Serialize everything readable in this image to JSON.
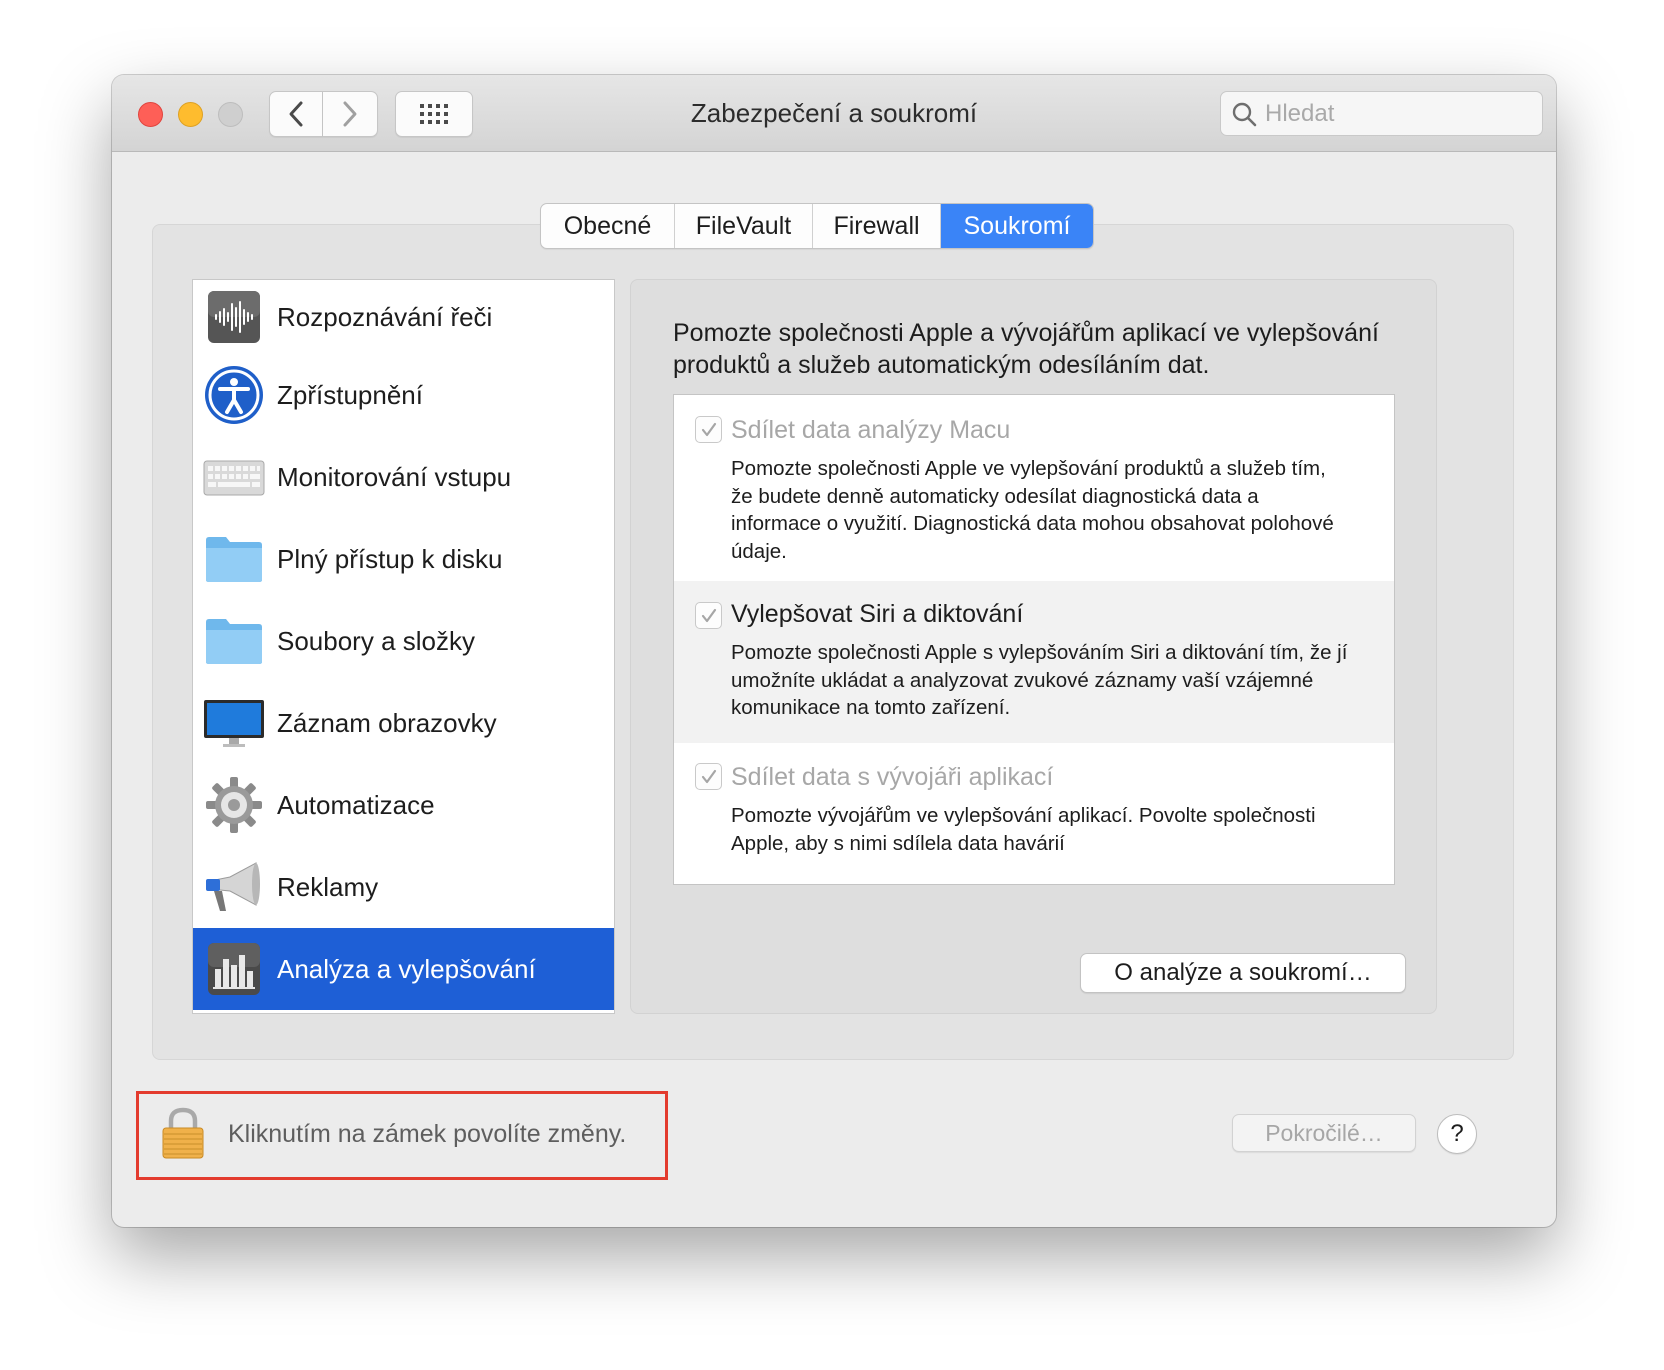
{
  "window": {
    "title": "Zabezpečení a soukromí",
    "search_placeholder": "Hledat"
  },
  "tabs": [
    {
      "label": "Obecné",
      "active": false
    },
    {
      "label": "FileVault",
      "active": false
    },
    {
      "label": "Firewall",
      "active": false
    },
    {
      "label": "Soukromí",
      "active": true
    }
  ],
  "sidebar": {
    "items": [
      {
        "label": "Rozpoznávání řeči",
        "icon": "waveform-icon"
      },
      {
        "label": "Zpřístupnění",
        "icon": "accessibility-icon"
      },
      {
        "label": "Monitorování vstupu",
        "icon": "keyboard-icon"
      },
      {
        "label": "Plný přístup k disku",
        "icon": "folder-icon"
      },
      {
        "label": "Soubory a složky",
        "icon": "folder-icon"
      },
      {
        "label": "Záznam obrazovky",
        "icon": "display-icon"
      },
      {
        "label": "Automatizace",
        "icon": "gear-icon"
      },
      {
        "label": "Reklamy",
        "icon": "megaphone-icon"
      },
      {
        "label": "Analýza a vylepšování",
        "icon": "bar-chart-icon",
        "selected": true
      }
    ]
  },
  "panel": {
    "intro": "Pomozte společnosti Apple a vývojářům aplikací ve vylepšování produktů a služeb automatickým odesíláním dat.",
    "options": [
      {
        "title": "Sdílet data analýzy Macu",
        "checked": true,
        "enabled": false,
        "description": "Pomozte společnosti Apple ve vylepšování produktů a služeb tím, že budete denně automaticky odesílat diagnostická data a informace o využití. Diagnostická data mohou obsahovat polohové údaje."
      },
      {
        "title": "Vylepšovat Siri a diktování",
        "checked": true,
        "enabled": true,
        "description": "Pomozte společnosti Apple s vylepšováním Siri a diktování tím, že jí umožníte ukládat a analyzovat zvukové záznamy vaší vzájemné komunikace na tomto zařízení."
      },
      {
        "title": "Sdílet data s vývojáři aplikací",
        "checked": true,
        "enabled": false,
        "description": "Pomozte vývojářům ve vylepšování aplikací. Povolte společnosti Apple, aby s nimi sdílela data havárií"
      }
    ],
    "about_button": "O analýze a soukromí…"
  },
  "footer": {
    "lock_text": "Kliknutím na zámek povolíte změny.",
    "advanced_button": "Pokročilé…",
    "help_button": "?"
  },
  "colors": {
    "selection": "#1e5fd6",
    "tab_active": "#3a84f7",
    "highlight_border": "#e33b2e"
  }
}
